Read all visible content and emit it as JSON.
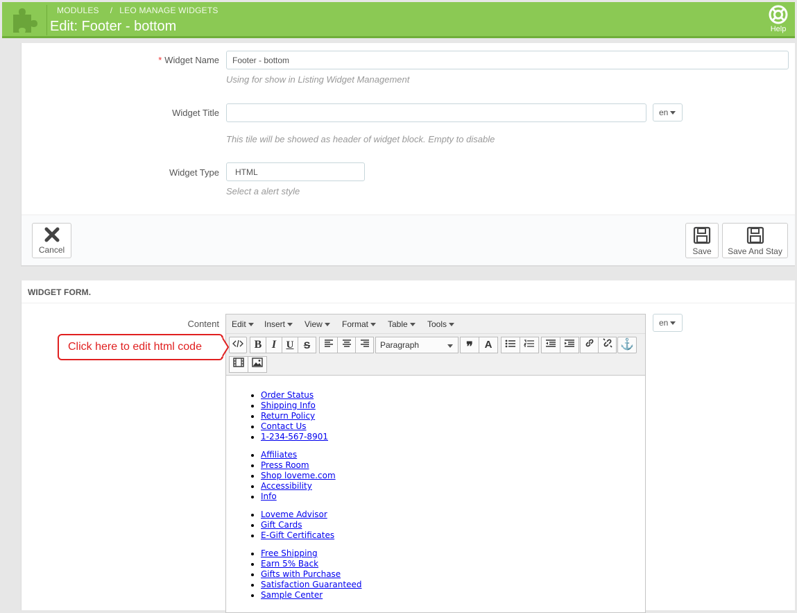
{
  "header": {
    "breadcrumb": [
      "MODULES",
      "LEO MANAGE WIDGETS"
    ],
    "breadcrumb_sep": "/",
    "title": "Edit: Footer - bottom",
    "help_label": "Help",
    "logo_icon": "puzzle-piece-icon",
    "accent": "#8bc954"
  },
  "form": {
    "widget_name": {
      "required_mark": "*",
      "label": "Widget Name",
      "value": "Footer - bottom",
      "help": "Using for show in Listing Widget Management"
    },
    "widget_title": {
      "label": "Widget Title",
      "value": "",
      "lang": "en",
      "help": "This tile will be showed as header of widget block. Empty to disable"
    },
    "widget_type": {
      "label": "Widget Type",
      "value": "HTML",
      "help": "Select a alert style"
    },
    "actions": {
      "cancel": "Cancel",
      "save": "Save",
      "save_and_stay": "Save And Stay"
    }
  },
  "widget_form": {
    "heading": "WIDGET FORM.",
    "content_label": "Content",
    "lang": "en",
    "menu": [
      "Edit",
      "Insert",
      "View",
      "Format",
      "Table",
      "Tools"
    ],
    "format_value": "Paragraph",
    "toolbar_icons": [
      "code-icon",
      "bold-icon",
      "italic-icon",
      "underline-icon",
      "strikethrough-icon",
      "align-left-icon",
      "align-center-icon",
      "align-right-icon",
      "blockquote-icon",
      "text-color-icon",
      "bullet-list-icon",
      "numbered-list-icon",
      "outdent-icon",
      "indent-icon",
      "link-icon",
      "unlink-icon",
      "anchor-icon",
      "media-icon",
      "image-icon"
    ],
    "lists": [
      [
        "Order Status",
        "Shipping Info",
        "Return Policy",
        "Contact Us",
        "1-234-567-8901"
      ],
      [
        "Affiliates",
        "Press Room",
        "Shop loveme.com",
        "Accessibility",
        "Info"
      ],
      [
        "Loveme Advisor",
        "Gift Cards",
        "E-Gift Certificates"
      ],
      [
        "Free Shipping",
        "Earn 5% Back",
        "Gifts with Purchase",
        "Satisfaction Guaranteed",
        "Sample Center"
      ]
    ]
  },
  "callout": {
    "text": "Click here to edit html code",
    "color": "#e02020"
  }
}
